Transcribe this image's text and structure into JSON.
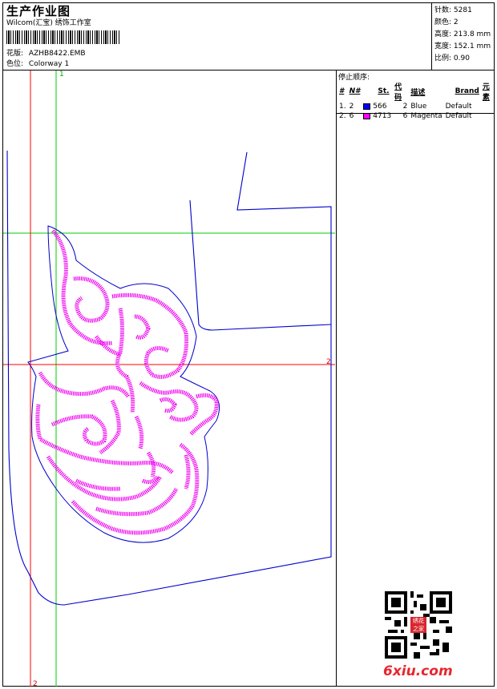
{
  "header": {
    "title": "生产作业图",
    "studio": "Wilcom(汇宝) 绣饰工作室",
    "design_label": "花版:",
    "design_file": "AZHB8422.EMB",
    "colorway_label": "色位:",
    "colorway": "Colorway 1"
  },
  "stats": {
    "stitches_label": "针数:",
    "stitches": "5281",
    "colors_label": "颜色:",
    "colors": "2",
    "height_label": "高度:",
    "height": "213.8 mm",
    "width_label": "宽度:",
    "width": "152.1 mm",
    "scale_label": "比例:",
    "scale": "0.90"
  },
  "stop_sequence": {
    "title": "停止顺序:",
    "headers": [
      "#",
      "N#",
      "St.",
      "代码",
      "描述",
      "Brand",
      "元素"
    ],
    "rows": [
      {
        "idx": "1.",
        "n": "2",
        "color": "#0000ff",
        "stitches": "566",
        "code": "2",
        "desc": "Blue",
        "brand": "Default"
      },
      {
        "idx": "2.",
        "n": "6",
        "color": "#ff00ff",
        "stitches": "4713",
        "code": "6",
        "desc": "Magenta",
        "brand": "Default"
      }
    ]
  },
  "axes": {
    "green_top": "1",
    "red_right": "2",
    "red_bottom": "2"
  },
  "watermark": {
    "site": "6xiu.com",
    "seal": "绣花之家"
  },
  "colors": {
    "outline": "#0000cc",
    "fill": "#ff00ff",
    "guide_green": "#00cc00",
    "guide_red": "#ff0000"
  }
}
